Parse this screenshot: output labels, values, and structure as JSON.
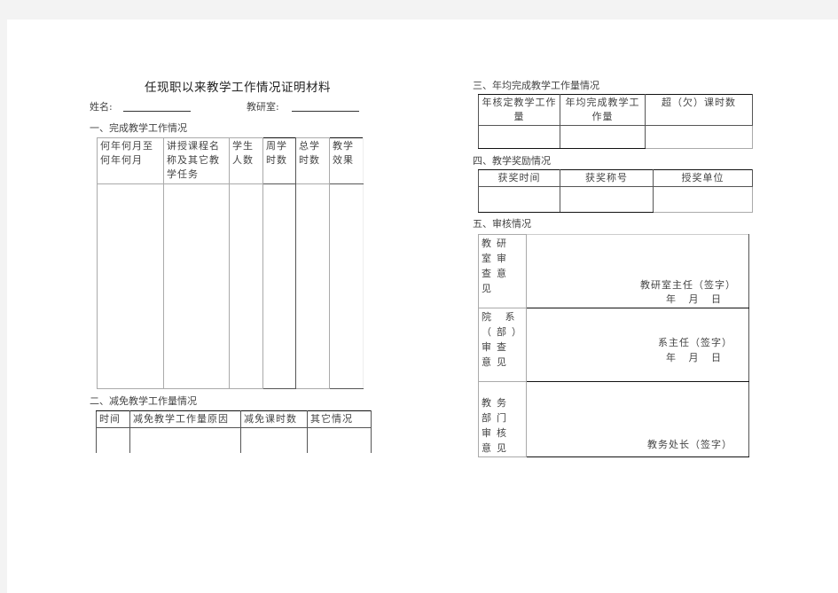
{
  "document": {
    "title": "任现职以来教学工作情况证明材料",
    "name_label": "姓名:",
    "office_label": "教研室:"
  },
  "section1": {
    "heading": "一、完成教学工作情况",
    "columns": [
      "何年何月至何年何月",
      "讲授课程名称及其它教学任务",
      "学生人数",
      "周学时数",
      "总学时数",
      "教学效果"
    ],
    "rows": []
  },
  "section2": {
    "heading": "二、减免教学工作量情况",
    "columns": [
      "时间",
      "减免教学工作量原因",
      "减免课时数",
      "其它情况"
    ],
    "rows": []
  },
  "section3": {
    "heading": "三、年均完成教学工作量情况",
    "columns": [
      "年核定教学工作量",
      "年均完成教学工作量",
      "超（欠）课时数"
    ],
    "rows": []
  },
  "section4": {
    "heading": "四、教学奖励情况",
    "columns": [
      "获奖时间",
      "获奖称号",
      "授奖单位"
    ],
    "rows": []
  },
  "section5": {
    "heading": "五、审核情况",
    "rows": [
      {
        "label": "教研室审查意见",
        "signature": "教研室主任（签字）",
        "date": "年   月   日"
      },
      {
        "label": "院 系（部）审查意见",
        "signature": "系主任（签字）",
        "date": "年   月   日"
      },
      {
        "label": "教务部门审核意见",
        "signature": "教务处长（签字）",
        "date": ""
      }
    ]
  }
}
